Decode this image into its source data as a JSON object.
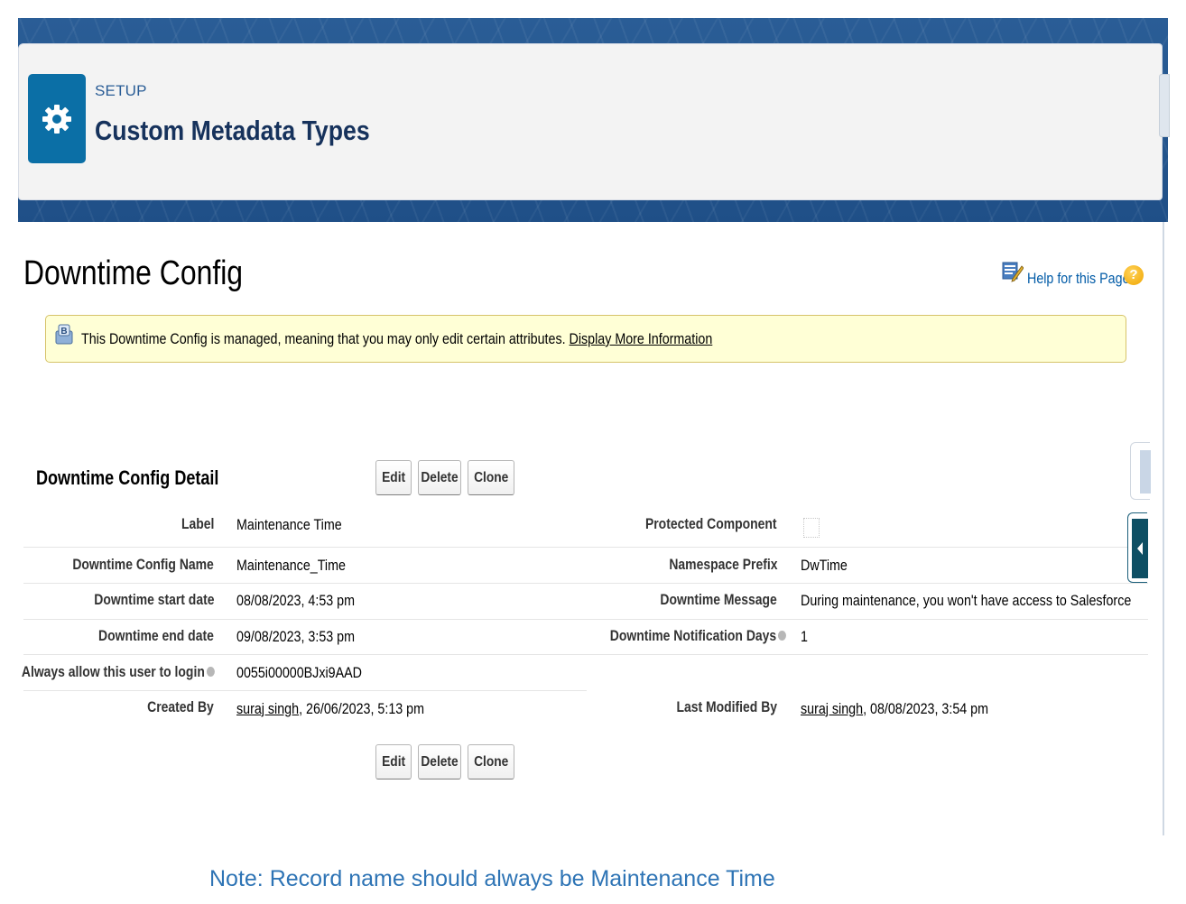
{
  "header": {
    "eyebrow": "SETUP",
    "title": "Custom Metadata Types",
    "icon": "gear-icon"
  },
  "page": {
    "title": "Downtime Config",
    "help_link": "Help for this Page",
    "help_icon": "help-question-icon"
  },
  "managed_message": {
    "text": "This Downtime Config is managed, meaning that you may only edit certain attributes.",
    "link": "Display More Information"
  },
  "detail": {
    "section_title": "Downtime Config Detail",
    "buttons": {
      "edit": "Edit",
      "delete": "Delete",
      "clone": "Clone"
    },
    "left_fields": [
      {
        "label": "Label",
        "value": "Maintenance Time"
      },
      {
        "label": "Downtime Config Name",
        "value": "Maintenance_Time"
      },
      {
        "label": "Downtime start date",
        "value": "08/08/2023, 4:53 pm"
      },
      {
        "label": "Downtime end date",
        "value": "09/08/2023, 3:53 pm"
      },
      {
        "label": "Always allow this user to login",
        "value": "0055i00000BJxi9AAD"
      }
    ],
    "right_fields": [
      {
        "label": "Protected Component",
        "value": ""
      },
      {
        "label": "Namespace Prefix",
        "value": "DwTime"
      },
      {
        "label": "Downtime Message",
        "value": "During maintenance, you won't have access to Salesforce"
      },
      {
        "label": "Downtime Notification Days",
        "value": "1"
      }
    ],
    "created_by": {
      "label": "Created By",
      "user": "suraj singh",
      "date": ", 26/06/2023, 5:13 pm"
    },
    "last_modified_by": {
      "label": "Last Modified By",
      "user": "suraj singh",
      "date": ", 08/08/2023, 3:54 pm"
    }
  },
  "note": "Note: Record name should always be Maintenance Time",
  "colors": {
    "brand_blue": "#0b6fa6",
    "header_title": "#16325c",
    "link_blue": "#015ba7",
    "note_blue": "#2e74b5",
    "message_bg": "#ffffd6"
  }
}
